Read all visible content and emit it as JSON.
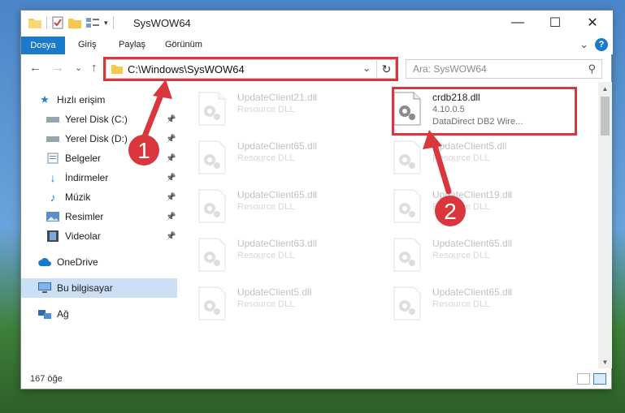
{
  "window": {
    "title": "SysWOW64"
  },
  "title_buttons": {
    "minimize": "—",
    "maximize": "☐",
    "close": "✕"
  },
  "ribbon": {
    "tabs": [
      "Dosya",
      "Giriş",
      "Paylaş",
      "Görünüm"
    ],
    "expand_glyph": "⌄",
    "help_glyph": "?"
  },
  "nav": {
    "back": "←",
    "forward": "→",
    "recent": "⌄",
    "up": "↑",
    "address": "C:\\Windows\\SysWOW64",
    "address_dropdown": "⌄",
    "refresh": "↻",
    "search_placeholder": "Ara: SysWOW64",
    "search_glyph": "⚲"
  },
  "sidebar": {
    "quick_access": "Hızlı erişim",
    "items": [
      {
        "label": "Yerel Disk (C:)",
        "icon": "drive-icon"
      },
      {
        "label": "Yerel Disk (D:)",
        "icon": "drive-icon"
      },
      {
        "label": "Belgeler",
        "icon": "documents-icon"
      },
      {
        "label": "İndirmeler",
        "icon": "downloads-icon"
      },
      {
        "label": "Müzik",
        "icon": "music-icon"
      },
      {
        "label": "Resimler",
        "icon": "pictures-icon"
      },
      {
        "label": "Videolar",
        "icon": "videos-icon"
      }
    ],
    "pin_glyph": "📌",
    "onedrive": "OneDrive",
    "this_pc": "Bu bilgisayar",
    "network": "Ağ"
  },
  "files": [
    {
      "name": "UpdateClient21.dll",
      "sub1": "Resource DLL",
      "sub2": "",
      "faded": true
    },
    {
      "name": "crdb218.dll",
      "sub1": "4.10.0.5",
      "sub2": "DataDirect DB2 Wire...",
      "faded": false
    },
    {
      "name": "UpdateClient65.dll",
      "sub1": "Resource DLL",
      "sub2": "",
      "faded": true
    },
    {
      "name": "UpdateClient5.dll",
      "sub1": "Resource DLL",
      "sub2": "",
      "faded": true
    },
    {
      "name": "UpdateClient65.dll",
      "sub1": "Resource DLL",
      "sub2": "",
      "faded": true
    },
    {
      "name": "UpdateClient19.dll",
      "sub1": "Resource DLL",
      "sub2": "",
      "faded": true
    },
    {
      "name": "UpdateClient63.dll",
      "sub1": "Resource DLL",
      "sub2": "",
      "faded": true
    },
    {
      "name": "UpdateClient65.dll",
      "sub1": "Resource DLL",
      "sub2": "",
      "faded": true
    },
    {
      "name": "UpdateClient5.dll",
      "sub1": "Resource DLL",
      "sub2": "",
      "faded": true
    },
    {
      "name": "UpdateClient65.dll",
      "sub1": "Resource DLL",
      "sub2": "",
      "faded": true
    }
  ],
  "scroll": {
    "up": "▲",
    "down": "▼"
  },
  "status": {
    "count": "167 öğe"
  },
  "annotations": {
    "badge_1": "1",
    "badge_2": "2",
    "color": "#d9363e"
  },
  "colors": {
    "accent": "#1979ca",
    "selection": "#cce0f5"
  }
}
